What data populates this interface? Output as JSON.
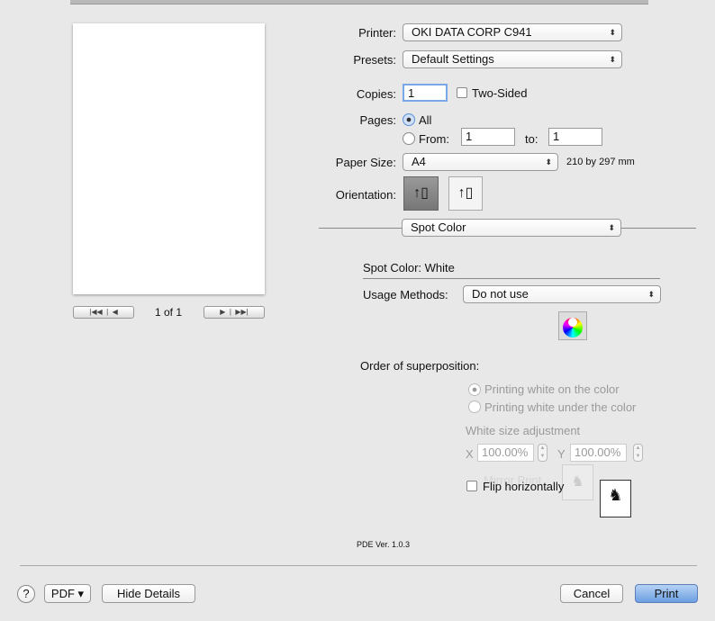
{
  "printer": {
    "label": "Printer:",
    "value": "OKI DATA CORP C941"
  },
  "presets": {
    "label": "Presets:",
    "value": "Default Settings"
  },
  "copies": {
    "label": "Copies:",
    "value": "1",
    "two_sided": "Two-Sided"
  },
  "pages": {
    "label": "Pages:",
    "all": "All",
    "from": "From:",
    "from_value": "1",
    "to": "to:",
    "to_value": "1"
  },
  "paper": {
    "label": "Paper Size:",
    "value": "A4",
    "dims": "210 by 297 mm"
  },
  "orientation": {
    "label": "Orientation:"
  },
  "panel": {
    "value": "Spot Color"
  },
  "spot": {
    "title": "Spot Color: White",
    "usage_label": "Usage Methods:",
    "usage_value": "Do not use",
    "order_label": "Order of superposition:",
    "opt_on": "Printing white on the color",
    "opt_under": "Printing white under the color",
    "size_label": "White size adjustment",
    "x_label": "X",
    "x_value": "100.00%",
    "y_label": "Y",
    "y_value": "100.00%",
    "mirror": "Mirror Print",
    "flip": "Flip horizontally",
    "pde": "PDE Ver.  1.0.3"
  },
  "preview": {
    "page_count": "1 of 1"
  },
  "footer": {
    "help": "?",
    "pdf": "PDF ▾",
    "hide": "Hide Details",
    "cancel": "Cancel",
    "print": "Print"
  },
  "colors": {
    "accent": "#5a8fd6"
  }
}
